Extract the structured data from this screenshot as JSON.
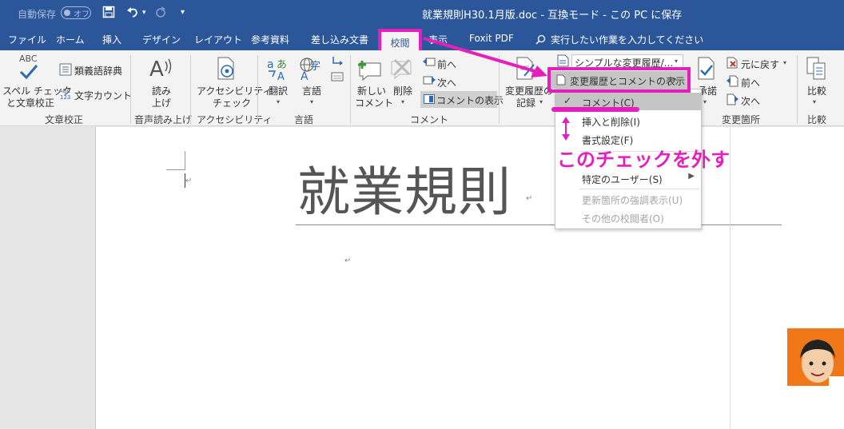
{
  "titlebar": {
    "autosave_label": "自動保存",
    "autosave_state": "オフ",
    "doc_title": "就業規則H30.1月版.doc  -  互換モード - この PC に保存"
  },
  "tabs": [
    {
      "label": "ファイル"
    },
    {
      "label": "ホーム"
    },
    {
      "label": "挿入"
    },
    {
      "label": "デザイン"
    },
    {
      "label": "レイアウト"
    },
    {
      "label": "参考資料"
    },
    {
      "label": "差し込み文書"
    },
    {
      "label": "校閲",
      "active": true
    },
    {
      "label": "表示"
    },
    {
      "label": "Foxit PDF"
    }
  ],
  "tellme": "実行したい作業を入力してください",
  "ribbon": {
    "proofing": {
      "abc": "ABC",
      "spell_check": "スペル チェック",
      "spell_check2": "と文章校正",
      "thesaurus": "類義語辞典",
      "wordcount": "文字カウント",
      "group": "文章校正"
    },
    "speech": {
      "read1": "読み",
      "read2": "上げ",
      "group": "音声読み上げ"
    },
    "accessibility": {
      "btn1": "アクセシビリティ",
      "btn2": "チェック",
      "group": "アクセシビリティ"
    },
    "language": {
      "translate": "翻訳",
      "language": "言語",
      "group": "言語"
    },
    "comments": {
      "new1": "新しい",
      "new2": "コメント",
      "delete": "削除",
      "prev": "前へ",
      "next": "次へ",
      "show": "コメントの表示",
      "group": "コメント"
    },
    "tracking": {
      "record1": "変更履歴の",
      "record2": "記録",
      "simple_markup": "シンプルな変更履歴/...",
      "show_markup": "変更履歴とコメントの表示"
    },
    "changes": {
      "accept": "承諾",
      "reject": "元に戻す",
      "prev": "前へ",
      "next": "次へ",
      "group": "変更箇所"
    },
    "compare": {
      "compare": "比較",
      "group": "比較"
    }
  },
  "dropdown": {
    "items": [
      {
        "label": "コメント(C)",
        "checked": true,
        "highlighted": true
      },
      {
        "label": "挿入と削除(I)"
      },
      {
        "label": "書式設定(F)"
      },
      {
        "label": "特定のユーザー(S)",
        "submenu": true
      },
      {
        "label": "更新箇所の強調表示(U)",
        "disabled": true
      },
      {
        "label": "その他の校閲者(O)",
        "disabled": true
      }
    ]
  },
  "document": {
    "title": "就業規則",
    "para_mark": "↵"
  },
  "annotation": {
    "text": "このチェックを外す",
    "color": "#e61ebe"
  },
  "colors": {
    "titlebar": "#2b579a",
    "ribbon": "#f3f3f3",
    "annotation": "#e61ebe"
  }
}
